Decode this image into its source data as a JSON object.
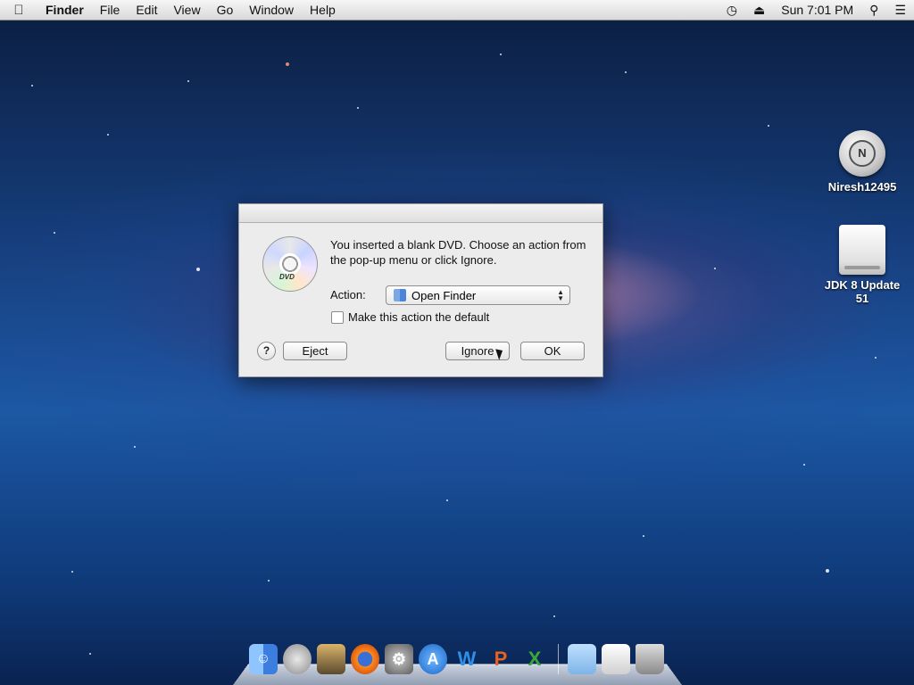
{
  "menubar": {
    "apple_icon": "apple-icon",
    "items": [
      "Finder",
      "File",
      "Edit",
      "View",
      "Go",
      "Window",
      "Help"
    ],
    "clock": "Sun 7:01 PM",
    "status_icons": [
      "time-machine-icon",
      "eject-icon",
      "spotlight-search-icon",
      "notification-list-icon"
    ]
  },
  "desktop": {
    "icons": [
      {
        "label": "Niresh12495",
        "icon": "user-disk-icon"
      },
      {
        "label": "JDK 8 Update 51",
        "icon": "external-drive-icon"
      }
    ]
  },
  "dialog": {
    "message": "You inserted a blank DVD. Choose an action from the pop-up menu or click Ignore.",
    "action_label": "Action:",
    "action_value": "Open Finder",
    "checkbox_label": "Make this action the default",
    "checkbox_checked": false,
    "help_label": "?",
    "eject_label": "Eject",
    "ignore_label": "Ignore",
    "ok_label": "OK",
    "dvd_badge": "DVD"
  },
  "dock": {
    "apps": [
      "finder-icon",
      "launchpad-icon",
      "photo-browser-icon",
      "firefox-icon",
      "system-preferences-icon",
      "app-store-icon",
      "word-icon",
      "powerpoint-icon",
      "excel-icon",
      "applications-folder-icon",
      "documents-stack-icon",
      "trash-icon"
    ]
  }
}
